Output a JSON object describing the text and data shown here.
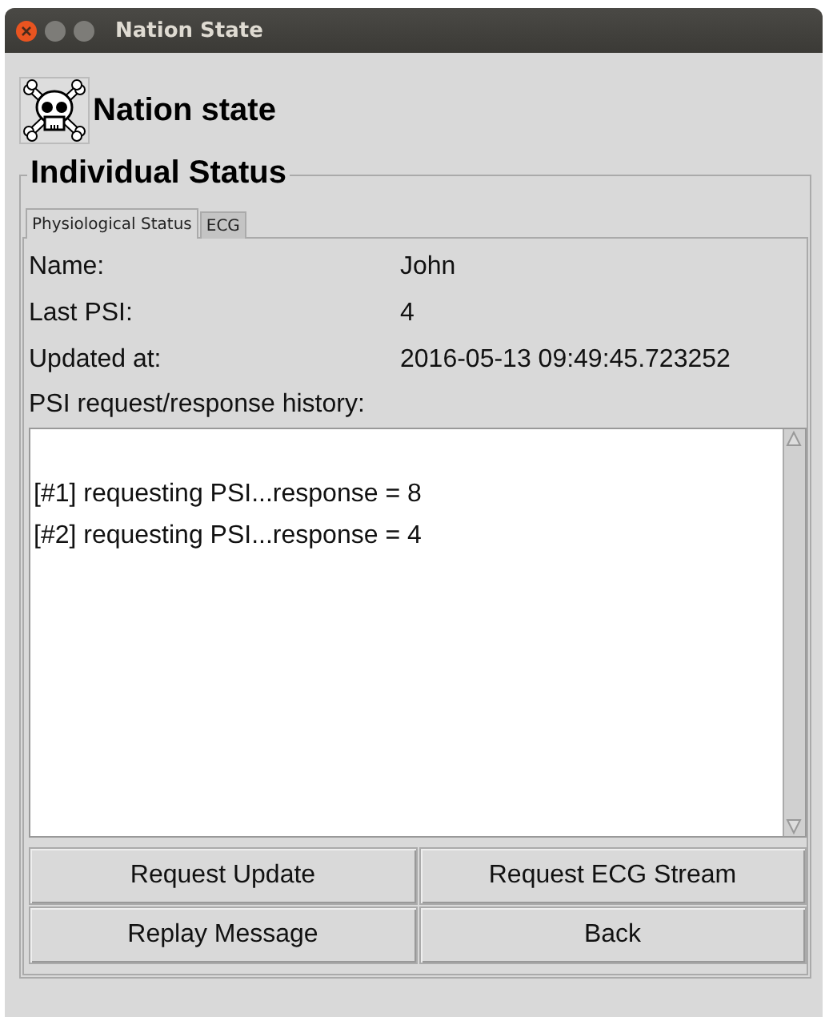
{
  "window": {
    "title": "Nation State"
  },
  "header": {
    "title": "Nation state"
  },
  "group": {
    "title": "Individual Status"
  },
  "tabs": [
    {
      "label": "Physiological Status",
      "selected": true
    },
    {
      "label": "ECG",
      "selected": false
    }
  ],
  "fields": [
    {
      "label": "Name:",
      "value": "John"
    },
    {
      "label": "Last PSI:",
      "value": "4"
    },
    {
      "label": "Updated at:",
      "value": "2016-05-13 09:49:45.723252"
    }
  ],
  "history": {
    "label": "PSI request/response history:",
    "lines": [
      "[#1] requesting PSI...response = 8",
      "[#2] requesting PSI...response = 4"
    ]
  },
  "buttons": [
    "Request Update",
    "Request ECG Stream",
    "Replay Message",
    "Back"
  ]
}
